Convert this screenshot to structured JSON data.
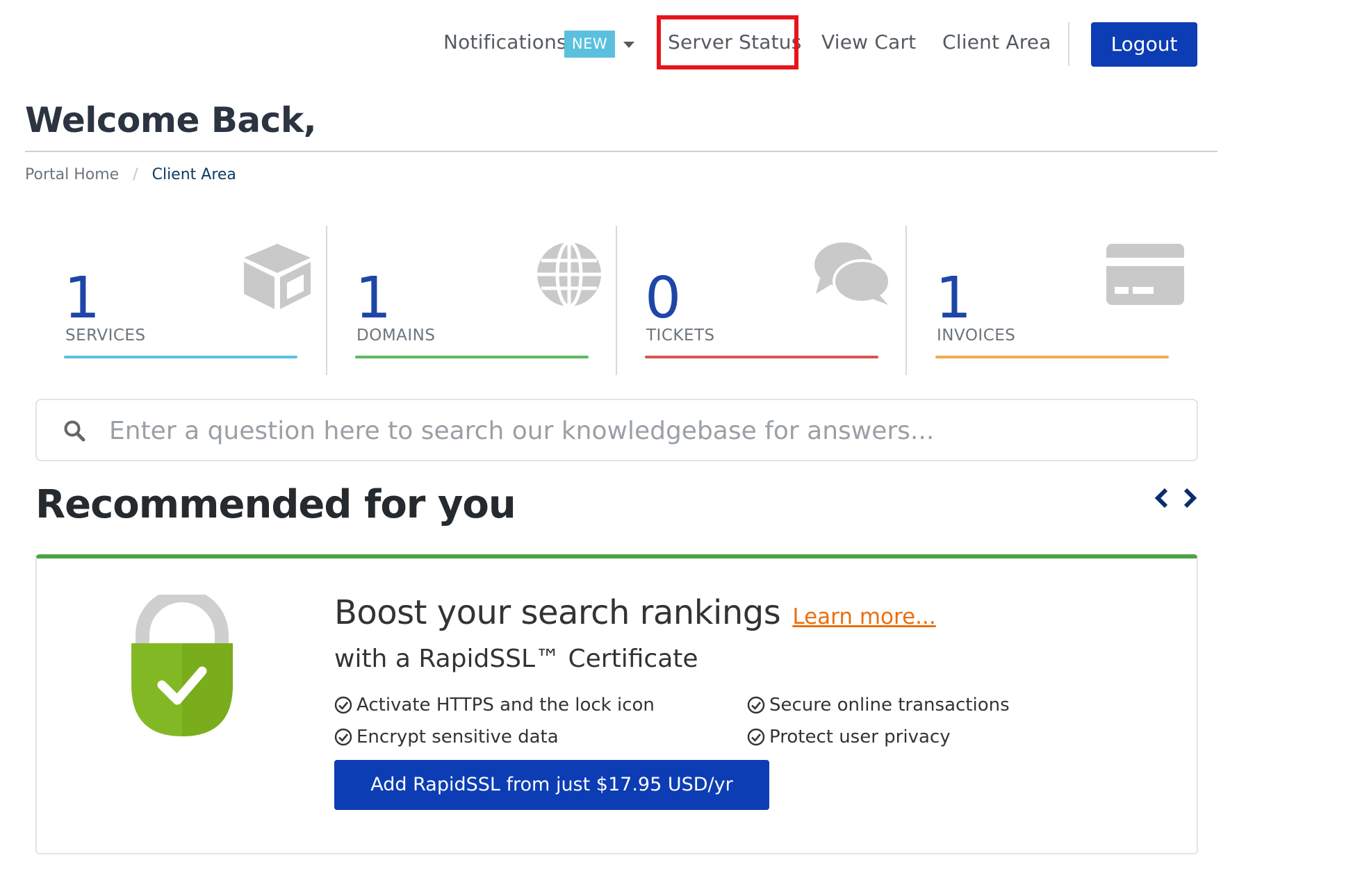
{
  "nav": {
    "notifications_label": "Notifications",
    "notifications_badge": "NEW",
    "server_status_label": "Server Status",
    "view_cart_label": "View Cart",
    "client_area_label": "Client Area",
    "logout_label": "Logout"
  },
  "header": {
    "title": "Welcome Back,"
  },
  "breadcrumb": {
    "home": "Portal Home",
    "separator": "/",
    "current": "Client Area"
  },
  "stats": [
    {
      "count": "1",
      "label": "SERVICES",
      "icon": "cube-icon",
      "accent": "#5bc0de"
    },
    {
      "count": "1",
      "label": "DOMAINS",
      "icon": "globe-icon",
      "accent": "#5cb85c"
    },
    {
      "count": "0",
      "label": "TICKETS",
      "icon": "comments-icon",
      "accent": "#d9534f"
    },
    {
      "count": "1",
      "label": "INVOICES",
      "icon": "credit-card-icon",
      "accent": "#f0ad4e"
    }
  ],
  "search": {
    "placeholder": "Enter a question here to search our knowledgebase for answers..."
  },
  "recommended": {
    "title": "Recommended for you",
    "promo": {
      "headline": "Boost your search rankings",
      "learn_more": "Learn more...",
      "subhead": "with a RapidSSL™ Certificate",
      "features": [
        "Activate HTTPS and the lock icon",
        "Encrypt sensitive data",
        "Secure online transactions",
        "Protect user privacy"
      ],
      "cta": "Add RapidSSL from just $17.95 USD/yr"
    }
  },
  "colors": {
    "brand_blue": "#0d3db4",
    "highlight_red": "#e8141c",
    "promo_green": "#4aa346"
  }
}
